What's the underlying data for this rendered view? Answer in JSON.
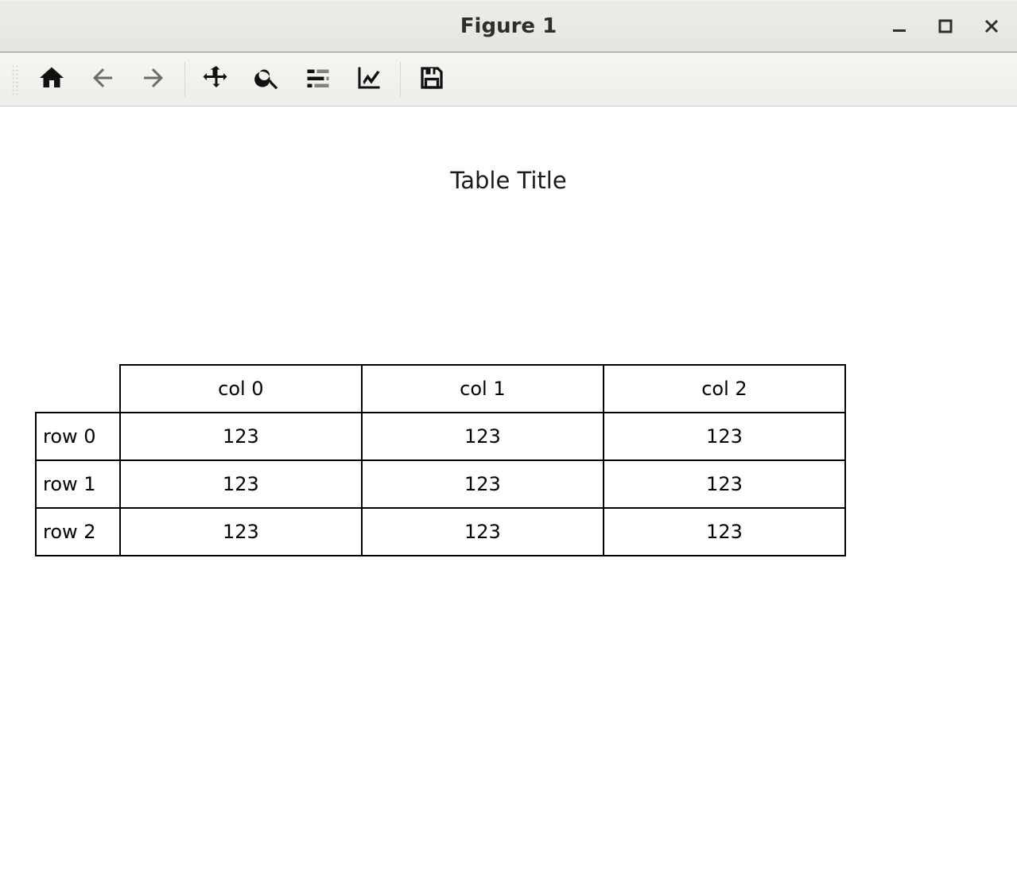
{
  "window": {
    "title": "Figure 1"
  },
  "toolbar": {
    "home": "Home",
    "back": "Back",
    "forward": "Forward",
    "pan": "Pan",
    "zoom": "Zoom",
    "subplots": "Configure subplots",
    "edit": "Edit axis",
    "save": "Save"
  },
  "chart_data": {
    "type": "table",
    "title": "Table Title",
    "columns": [
      "col 0",
      "col 1",
      "col 2"
    ],
    "row_labels": [
      "row 0",
      "row 1",
      "row 2"
    ],
    "cells": [
      [
        "123",
        "123",
        "123"
      ],
      [
        "123",
        "123",
        "123"
      ],
      [
        "123",
        "123",
        "123"
      ]
    ]
  }
}
